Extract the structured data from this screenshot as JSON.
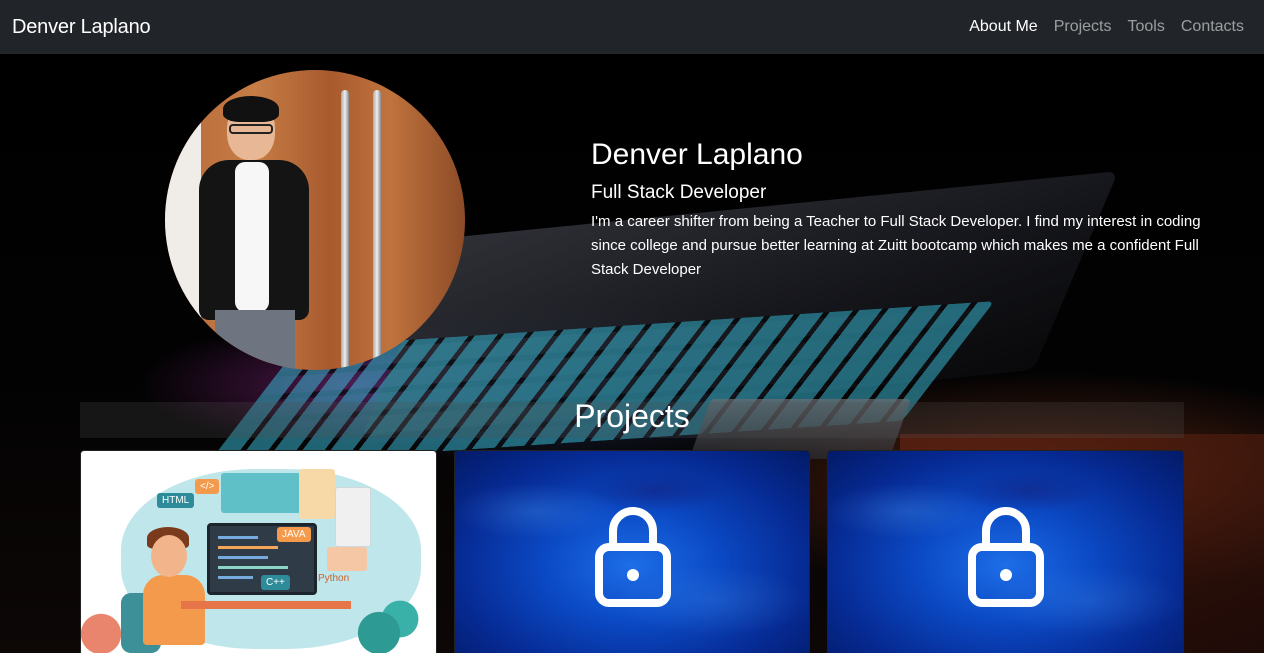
{
  "navbar": {
    "brand": "Denver Laplano",
    "links": [
      {
        "label": "About Me",
        "active": true
      },
      {
        "label": "Projects",
        "active": false
      },
      {
        "label": "Tools",
        "active": false
      },
      {
        "label": "Contacts",
        "active": false
      }
    ]
  },
  "about": {
    "name": "Denver Laplano",
    "role": "Full Stack Developer",
    "bio": "I'm a career shifter from being a Teacher to Full Stack Developer. I find my interest in coding since college and pursue better learning at Zuitt bootcamp which makes me a confident Full Stack Developer"
  },
  "projects": {
    "heading": "Projects",
    "cards": [
      {
        "kind": "illustration",
        "tags": [
          "HTML",
          "</>",
          "JAVA",
          "C++",
          "Python"
        ]
      },
      {
        "kind": "locked",
        "icon": "lock-icon"
      },
      {
        "kind": "locked",
        "icon": "lock-icon"
      }
    ]
  },
  "colors": {
    "navbar_bg": "#212529",
    "nav_active": "#ffffff",
    "nav_inactive": "rgba(255,255,255,0.55)",
    "lock_card_blue": "#0b49c4"
  }
}
